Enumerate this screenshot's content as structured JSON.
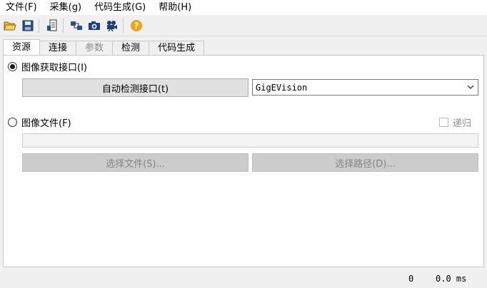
{
  "menu": {
    "items": [
      {
        "label": "文件(F)"
      },
      {
        "label": "采集(g)"
      },
      {
        "label": "代码生成(G)"
      },
      {
        "label": "帮助(H)"
      }
    ]
  },
  "toolbar": {
    "icons": [
      "open-folder-icon",
      "save-icon",
      "params-icon",
      "connect-icon",
      "snapshot-icon",
      "live-camera-icon",
      "help-icon"
    ],
    "colors": {
      "folder": "#e8b43a",
      "save": "#2b4f8c",
      "help": "#f5a00f"
    }
  },
  "tabs": [
    {
      "label": "资源",
      "active": true,
      "disabled": false
    },
    {
      "label": "连接",
      "active": false,
      "disabled": false
    },
    {
      "label": "参数",
      "active": false,
      "disabled": true
    },
    {
      "label": "检测",
      "active": false,
      "disabled": false
    },
    {
      "label": "代码生成",
      "active": false,
      "disabled": false
    }
  ],
  "resource": {
    "interface_radio_label": "图像获取接口(I)",
    "autodetect_button": "自动检测接口(t)",
    "interface_selected": "GigEVision",
    "image_file_radio_label": "图像文件(F)",
    "recursive_label": "递归",
    "file_path_value": "",
    "select_file_button": "选择文件(S)...",
    "select_path_button": "选择路径(D)..."
  },
  "status": {
    "count": "0",
    "time": "0.0 ms"
  }
}
